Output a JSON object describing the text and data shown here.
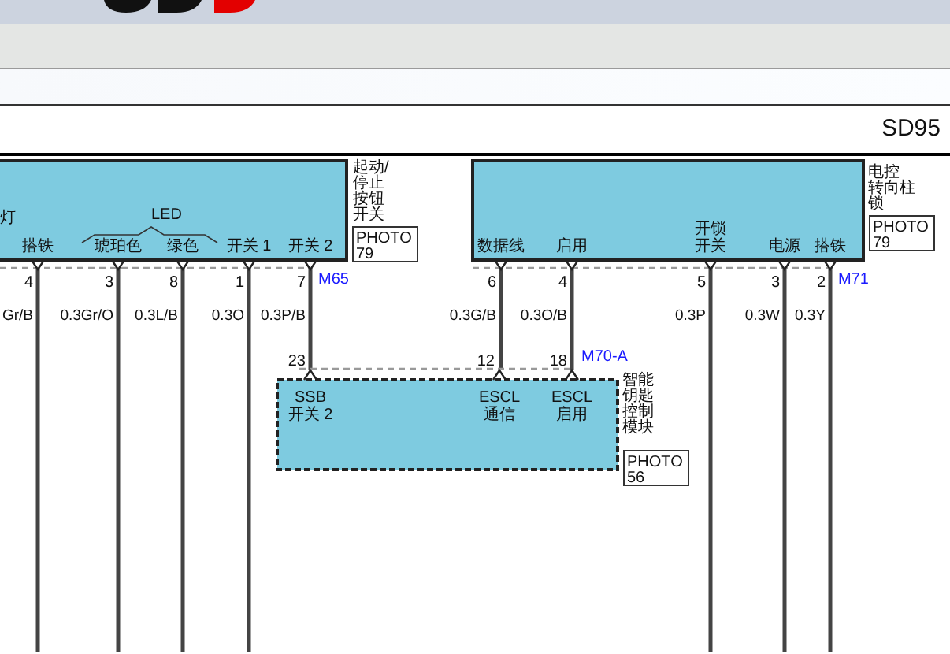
{
  "header": {
    "title": "SD95"
  },
  "modules": [
    {
      "kind": "solid",
      "name_lines": [
        "起动/",
        "停止",
        "按钮",
        "开关"
      ],
      "photo": [
        "PHOTO",
        "79"
      ],
      "connector": "M65",
      "group_labels": [
        "灯",
        "LED"
      ],
      "pins": [
        {
          "label": [
            "搭铁"
          ],
          "number": "4",
          "wire": "Gr/B"
        },
        {
          "label": [
            "琥珀色"
          ],
          "number": "3",
          "wire": "0.3Gr/O"
        },
        {
          "label": [
            "绿色"
          ],
          "number": "8",
          "wire": "0.3L/B"
        },
        {
          "label": [
            "开关 1"
          ],
          "number": "1",
          "wire": "0.3O"
        },
        {
          "label": [
            "开关 2"
          ],
          "number": "7",
          "wire": "0.3P/B"
        }
      ]
    },
    {
      "kind": "solid",
      "name_lines": [
        "电控",
        "转向柱",
        "锁"
      ],
      "photo": [
        "PHOTO",
        "79"
      ],
      "connector": "M71",
      "pins": [
        {
          "label": [
            "数据线"
          ],
          "number": "6",
          "wire": "0.3G/B"
        },
        {
          "label": [
            "启用"
          ],
          "number": "4",
          "wire": "0.3O/B"
        },
        {
          "label": [
            "开锁",
            "开关"
          ],
          "number": "5",
          "wire": "0.3P"
        },
        {
          "label": [
            "电源"
          ],
          "number": "3",
          "wire": "0.3W"
        },
        {
          "label": [
            "搭铁"
          ],
          "number": "2",
          "wire": "0.3Y"
        }
      ]
    },
    {
      "kind": "dashed",
      "name_lines": [
        "智能",
        "钥匙",
        "控制",
        "模块"
      ],
      "photo": [
        "PHOTO",
        "56"
      ],
      "connector": "M70-A",
      "pins": [
        {
          "label": [
            "SSB",
            "开关 2"
          ],
          "number": "23"
        },
        {
          "label": [
            "ESCL",
            "通信"
          ],
          "number": "12"
        },
        {
          "label": [
            "ESCL",
            "启用"
          ],
          "number": "18"
        }
      ]
    }
  ]
}
